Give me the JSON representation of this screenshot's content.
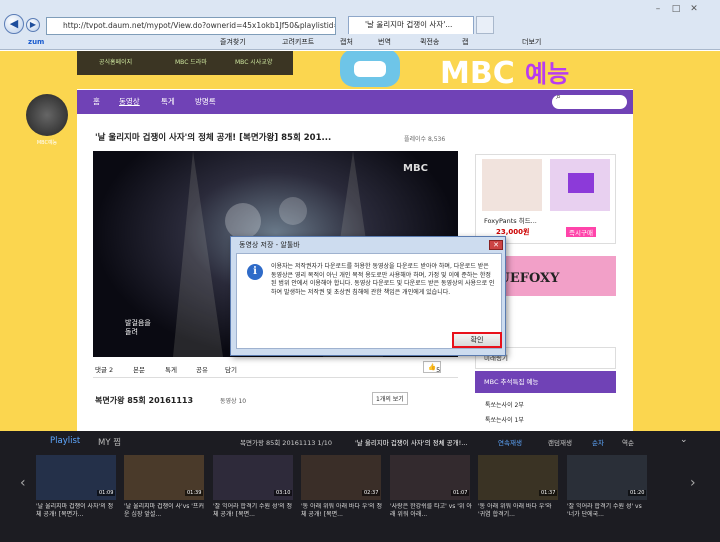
{
  "browser": {
    "address": "http://tvpot.daum.net/mypot/View.do?ownerid=45x1okb1Jf50&playlistid=686639&",
    "tab_title": "'날 울리지마 겁쟁이 사자'...",
    "toolbar": [
      "zum",
      "즐겨찾기",
      "고려키프트",
      "캡처",
      "번역",
      "퀵전송",
      "캡",
      "더보기"
    ]
  },
  "site": {
    "top_links": [
      "공식홈페이지",
      "MBC 드라마",
      "MBC 시사교양"
    ],
    "banner_text": "예능",
    "nav": [
      "홈",
      "동영상",
      "톡게",
      "방명록"
    ],
    "channel_name": "MBC예능"
  },
  "video": {
    "title": "'날 울리지마 겁쟁이 사자'의 정체 공개! [복면가왕] 85회 201...",
    "plays": "플레이수 8,536",
    "overlay_caption": "발걸음을\n돌려",
    "tabs": [
      "댓글 2",
      "본문",
      "톡게",
      "공유",
      "담기"
    ],
    "likes": "5"
  },
  "section": {
    "title": "복면가왕 85회 20161113",
    "count": "동영상 10",
    "sort": "1개의 보기"
  },
  "ads": {
    "product": "FoxyPants 히드...",
    "price": "23,000원",
    "badge": "즉시구매",
    "brand": "TRUEFOXY"
  },
  "sidebar": [
    "미래링기",
    "MBC 추석특집 예능",
    "톡쏘는사이 2부",
    "톡쏘는사이 1부"
  ],
  "playlist": {
    "tab_label": "Playlist",
    "tab2_label": "MY 찜",
    "now": "복면가왕 85회 20161113  1/10",
    "now_title": "'날 울리지마 겁쟁이 사자'의 정체 공개!...",
    "controls": [
      "연속재생",
      "랜덤재생",
      "순차",
      "역순"
    ],
    "items": [
      {
        "caption": "'날 울리지마 겁쟁이 사자'의 정체 공개! [복면가...",
        "dur": "01:09"
      },
      {
        "caption": "'날 울리지마 겁쟁이 사'vs '프커운 심장 앞설...",
        "dur": "01:39"
      },
      {
        "caption": "'잘 익어라 합격기 수원 성'의 정체 공개! [복면...",
        "dur": "03:10"
      },
      {
        "caption": "'동 아래 위워 아래 바다 우'의 정체 공개! [복면...",
        "dur": "02:37"
      },
      {
        "caption": "'사랑은 한강쉬를 타고' vs '위 아래 위워 아래...",
        "dur": "01:07"
      },
      {
        "caption": "'동 아래 위워 아래 바다 우'와 '귀염 합격기...",
        "dur": "01:37"
      },
      {
        "caption": "'잘 익어라 합격기 수원 성' vs '너가 단에국...",
        "dur": "01:20"
      }
    ]
  },
  "dialog": {
    "title": "동영상 저장 - 알툴바",
    "message": "이용자는 저작권자가 다운로드를 허용한 동영상을 다운로드 받아야 하며, 다운로드 받은 동영상은 영리 목적이 아닌 개인 목적 용도로만 사용해야 하며, 가정 및 이에 준하는 한정된 범위 안에서 이용해야 합니다. 동영상 다운로드 및 다운로드 받은 동영상의 사용으로 인하여 발생하는 저작권 및 초상권 침해에 관한 책임은 개인에게 있습니다.",
    "ok_label": "확인"
  }
}
